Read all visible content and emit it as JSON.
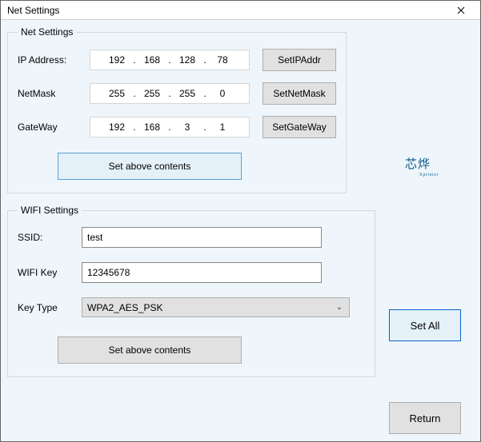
{
  "window": {
    "title": "Net Settings"
  },
  "net": {
    "legend": "Net Settings",
    "ip_label": "IP Address:",
    "mask_label": "NetMask",
    "gw_label": "GateWay",
    "ip": [
      "192",
      "168",
      "128",
      "78"
    ],
    "mask": [
      "255",
      "255",
      "255",
      "0"
    ],
    "gw": [
      "192",
      "168",
      "3",
      "1"
    ],
    "btn_ip": "SetIPAddr",
    "btn_mask": "SetNetMask",
    "btn_gw": "SetGateWay",
    "set_above": "Set above contents"
  },
  "wifi": {
    "legend": "WIFI Settings",
    "ssid_label": "SSID:",
    "ssid_value": "test",
    "key_label": "WIFI Key",
    "key_value": "12345678",
    "type_label": "Key Type",
    "type_value": "WPA2_AES_PSK",
    "set_above": "Set above contents"
  },
  "side": {
    "set_all": "Set All",
    "return": "Return"
  },
  "logo": {
    "cn": "芯烨",
    "sub": "Xprinter"
  }
}
